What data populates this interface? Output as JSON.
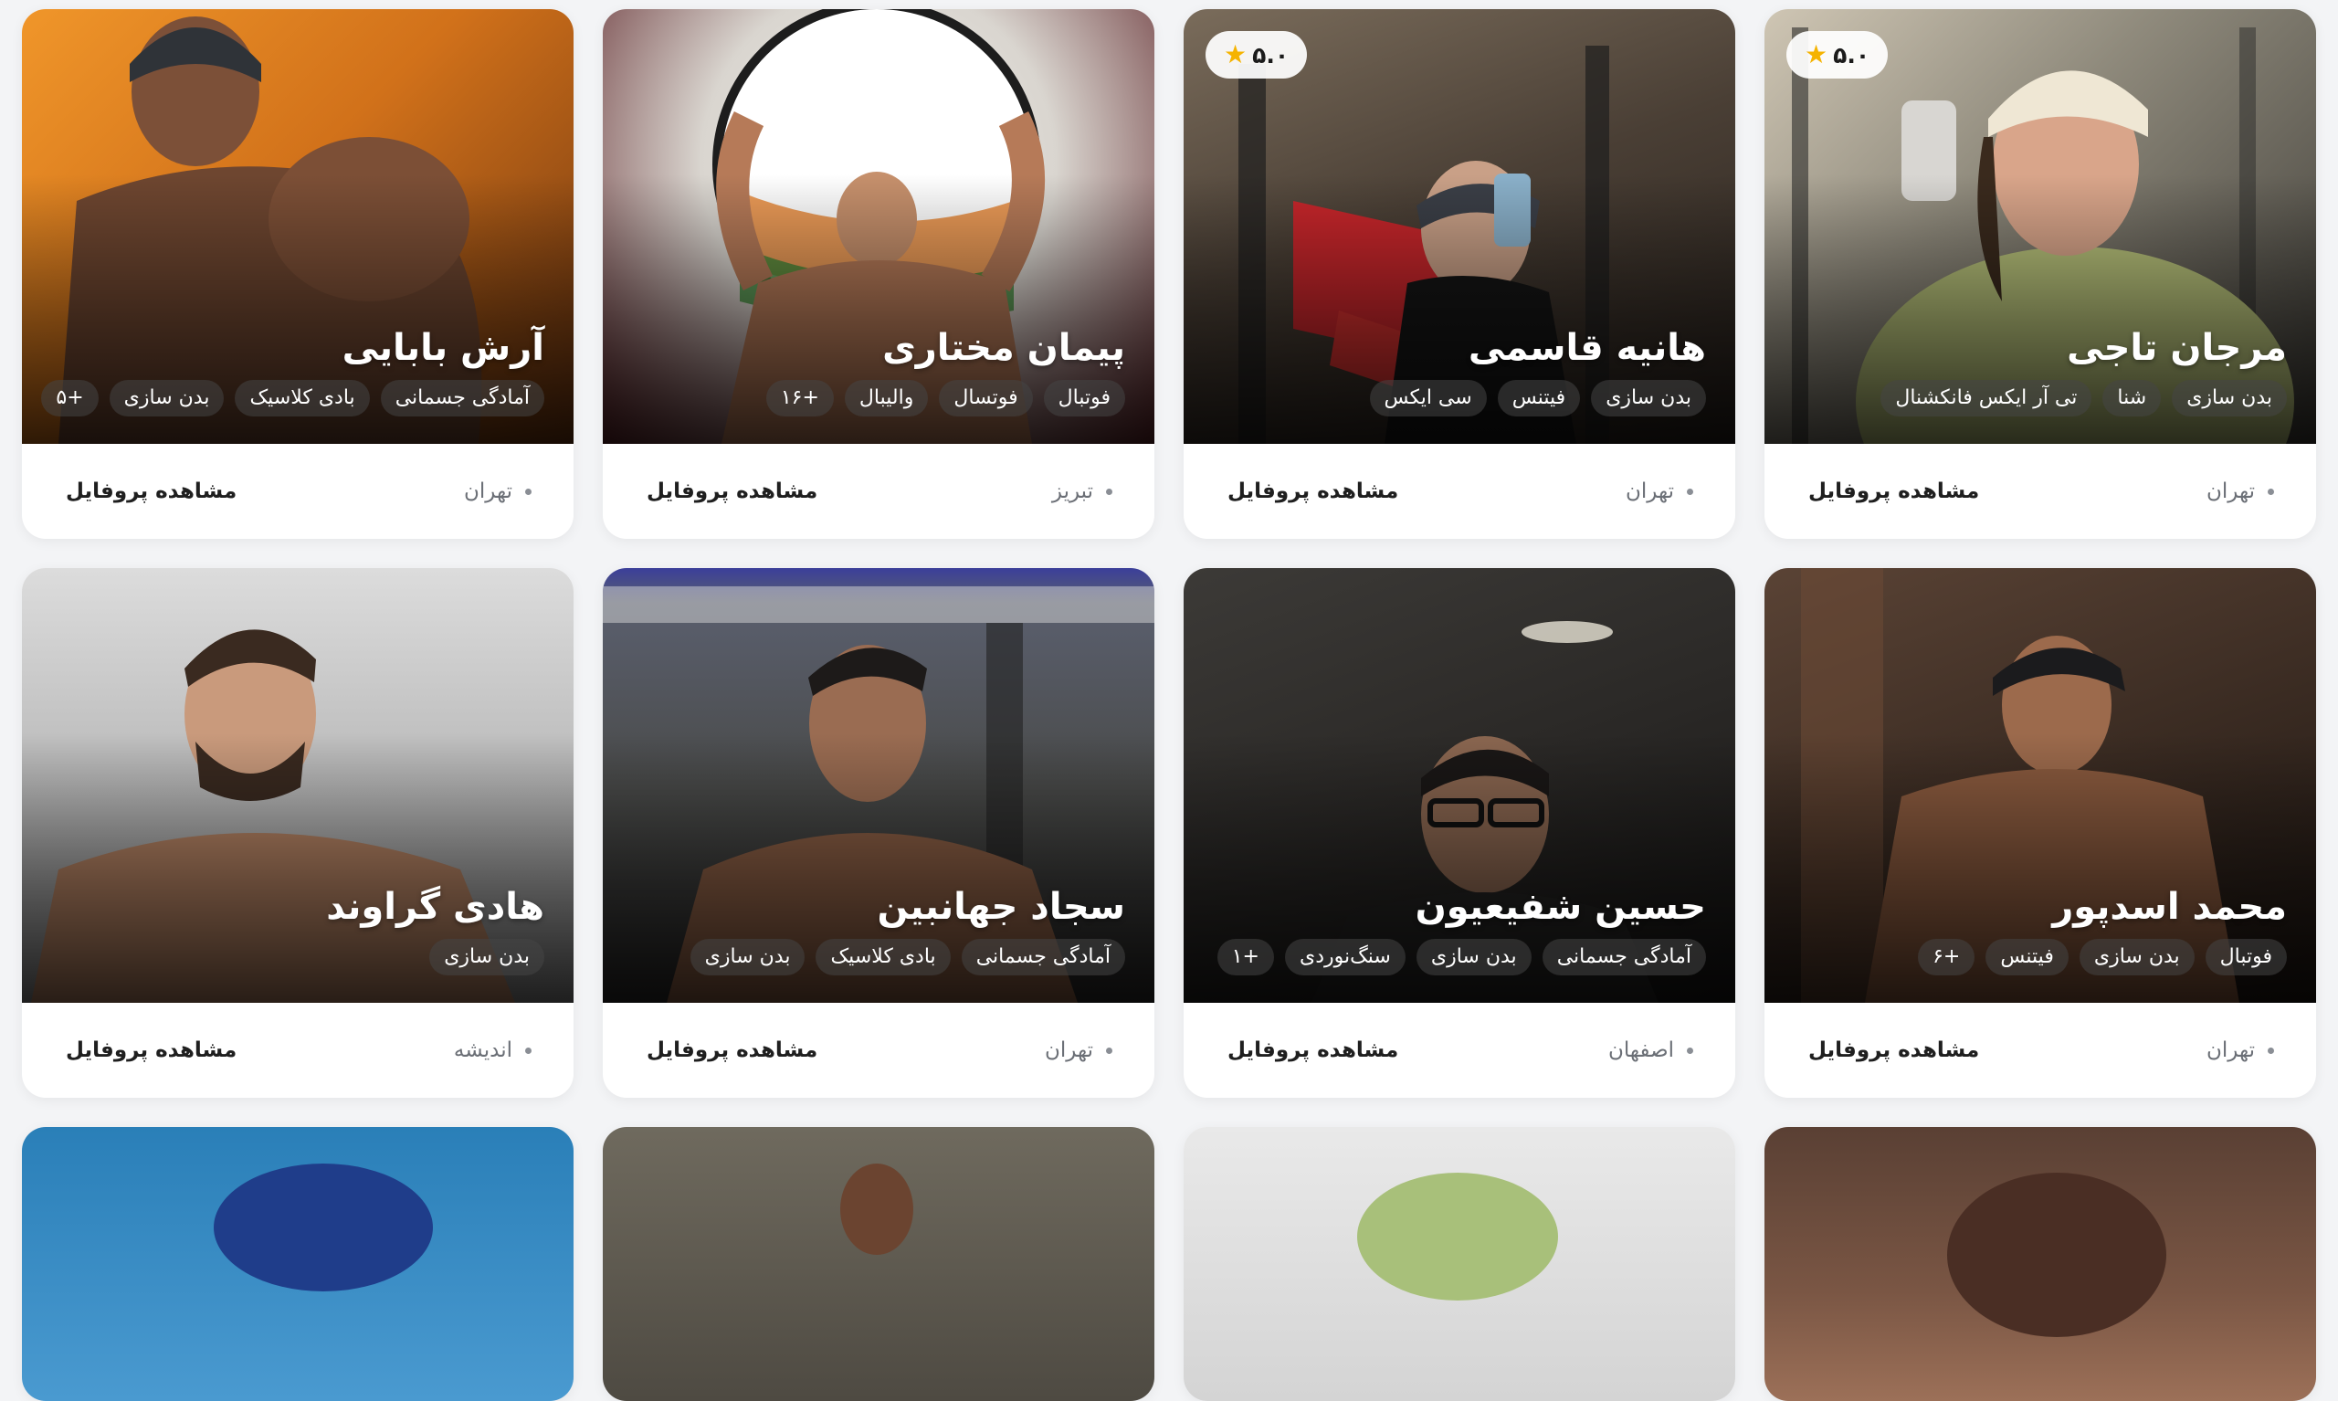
{
  "view_profile_label": "مشاهده پروفایل",
  "trainers": [
    {
      "name": "مرجان تاجی",
      "rating": "۵.۰",
      "tags": [
        "بدن سازی",
        "شنا",
        "تی آر ایکس فانکشنال"
      ],
      "city": "تهران"
    },
    {
      "name": "هانیه قاسمی",
      "rating": "۵.۰",
      "tags": [
        "بدن سازی",
        "فیتنس",
        "سی ایکس"
      ],
      "city": "تهران"
    },
    {
      "name": "پیمان مختاری",
      "tags": [
        "فوتبال",
        "فوتسال",
        "والیبال",
        "+۱۶"
      ],
      "city": "تبریز"
    },
    {
      "name": "آرش بابایی",
      "tags": [
        "آمادگی جسمانی",
        "بادی کلاسیک",
        "بدن سازی",
        "+۵"
      ],
      "city": "تهران"
    },
    {
      "name": "محمد اسدپور",
      "tags": [
        "فوتبال",
        "بدن سازی",
        "فیتنس",
        "+۶"
      ],
      "city": "تهران"
    },
    {
      "name": "حسین شفیعیون",
      "tags": [
        "آمادگی جسمانی",
        "بدن سازی",
        "سنگ‌نوردی",
        "+۱"
      ],
      "city": "اصفهان"
    },
    {
      "name": "سجاد جهانبین",
      "tags": [
        "آمادگی جسمانی",
        "بادی کلاسیک",
        "بدن سازی"
      ],
      "city": "تهران"
    },
    {
      "name": "هادی گراوند",
      "tags": [
        "بدن سازی"
      ],
      "city": "اندیشه"
    }
  ]
}
